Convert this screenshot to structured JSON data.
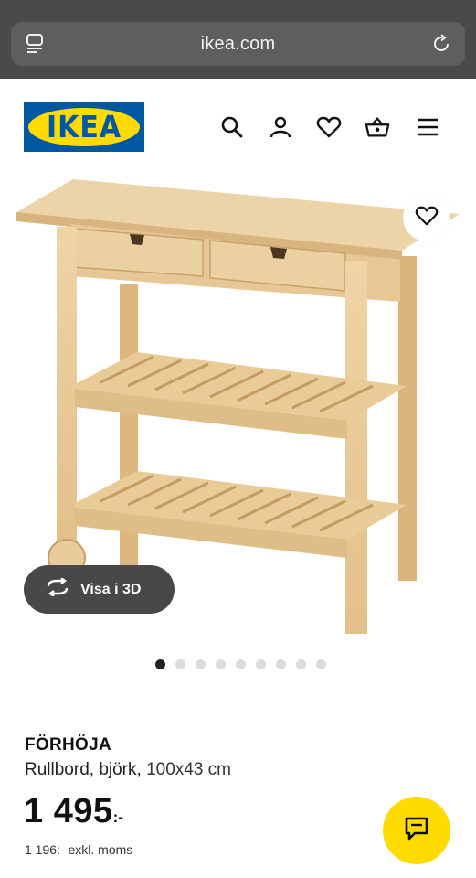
{
  "browser": {
    "url": "ikea.com"
  },
  "header": {
    "logo_text": "IKEA",
    "icons": [
      "search-icon",
      "account-icon",
      "heart-icon",
      "basket-icon",
      "menu-icon"
    ]
  },
  "gallery": {
    "view_3d_label": "Visa i 3D",
    "image_count": 9,
    "active_index": 0
  },
  "product": {
    "name": "FÖRHÖJA",
    "description": "Rullbord, björk, ",
    "size": "100x43 cm",
    "price": "1 495",
    "price_suffix": ":-",
    "price_excl": "1 196:- exkl. moms"
  },
  "colors": {
    "ikea_blue": "#0058a3",
    "ikea_yellow": "#ffdb00",
    "browser_bar": "#4a4a4a",
    "wood": "#e8c997"
  }
}
